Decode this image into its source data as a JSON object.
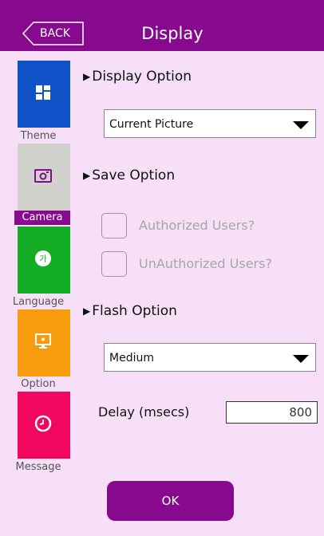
{
  "header": {
    "back_label": "BACK",
    "title": "Display"
  },
  "sidebar": {
    "items": [
      {
        "label": "Theme",
        "color": "#1052c7",
        "icon": "grid-icon",
        "active": false
      },
      {
        "label": "Camera",
        "color": "#d1d1cd",
        "icon": "camera-icon",
        "active": true
      },
      {
        "label": "Language",
        "color": "#12ac25",
        "icon": "language-icon",
        "active": false
      },
      {
        "label": "Option",
        "color": "#f69c0d",
        "icon": "monitor-icon",
        "active": false
      },
      {
        "label": "Message",
        "color": "#f2075f",
        "icon": "clock-icon",
        "active": false
      }
    ]
  },
  "display_option": {
    "heading": "Display Option",
    "selected": "Current Picture"
  },
  "save_option": {
    "heading": "Save Option",
    "authorized_label": "Authorized Users?",
    "unauthorized_label": "UnAuthorized Users?"
  },
  "flash_option": {
    "heading": "Flash Option",
    "selected": "Medium"
  },
  "delay": {
    "label": "Delay (msecs)",
    "value": "800"
  },
  "ok_label": "OK",
  "colors": {
    "accent": "#86098e",
    "background": "#f7dff7"
  }
}
